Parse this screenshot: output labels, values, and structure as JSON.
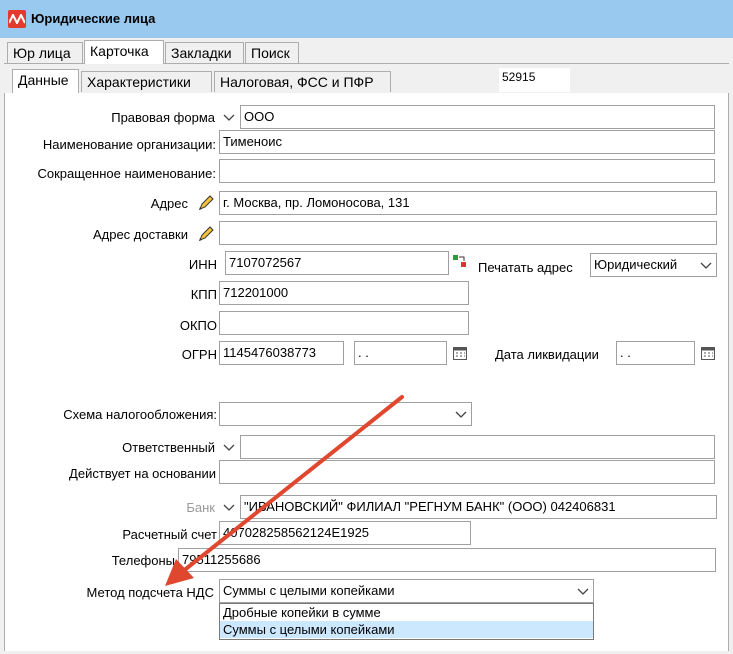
{
  "window": {
    "title": "Юридические лица"
  },
  "tabs": [
    {
      "label": "Юр лица"
    },
    {
      "label": "Карточка"
    },
    {
      "label": "Закладки"
    },
    {
      "label": "Поиск"
    }
  ],
  "subtabs": [
    {
      "label": "Данные"
    },
    {
      "label": "Характеристики"
    },
    {
      "label": "Налоговая, ФСС и ПФР"
    }
  ],
  "record_id": "52915",
  "form": {
    "legal_form": {
      "label": "Правовая форма",
      "value": "ООО"
    },
    "org_name": {
      "label": "Наименование организации:",
      "value": "Тименоис"
    },
    "short_name": {
      "label": "Сокращенное наименование:",
      "value": ""
    },
    "address": {
      "label": "Адрес",
      "value": "г. Москва, пр. Ломоносова, 131"
    },
    "delivery_address": {
      "label": "Адрес доставки",
      "value": ""
    },
    "inn": {
      "label": "ИНН",
      "value": "7107072567"
    },
    "print_address": {
      "label": "Печатать адрес",
      "value": "Юридический"
    },
    "kpp": {
      "label": "КПП",
      "value": "712201000"
    },
    "okpo": {
      "label": "ОКПО",
      "value": ""
    },
    "ogrn": {
      "label": "ОГРН",
      "value": "1145476038773",
      "date": " .  ."
    },
    "liquidation_date": {
      "label": "Дата ликвидации",
      "value": " .  ."
    },
    "tax_scheme": {
      "label": "Схема налогообложения:",
      "value": ""
    },
    "responsible": {
      "label": "Ответственный",
      "value": ""
    },
    "acts_on_basis": {
      "label": "Действует на основании",
      "value": ""
    },
    "bank": {
      "label": "Банк",
      "value": "\"ИВАНОВСКИЙ\" ФИЛИАЛ \"РЕГНУМ БАНК\" (ООО)  042406831"
    },
    "account": {
      "label": "Расчетный счет",
      "value": "407028258562124E1925"
    },
    "phones": {
      "label": "Телефоны",
      "value": "79511255686"
    },
    "vat_method": {
      "label": "Метод подсчета НДС",
      "value": "Суммы с целыми копейками",
      "options": [
        "Дробные копейки в сумме",
        "Суммы с целыми копейками"
      ]
    }
  },
  "colors": {
    "titlebar": "#99c9ef",
    "arrow": "#e0472f",
    "selected_option": "#cce8ff"
  }
}
